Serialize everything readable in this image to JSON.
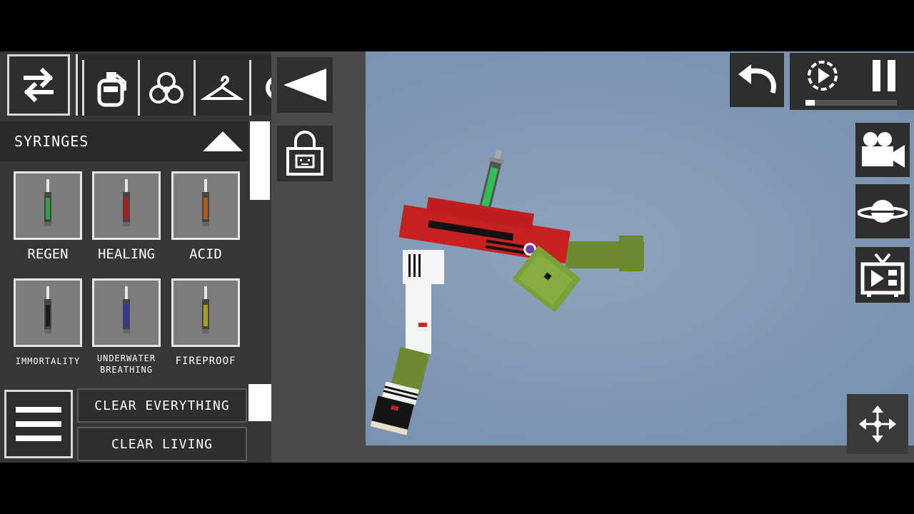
{
  "sidebar": {
    "category": "SYRINGES",
    "items": [
      {
        "label": "REGEN",
        "liquid": "#2fa14a"
      },
      {
        "label": "HEALING",
        "liquid": "#b21c1c"
      },
      {
        "label": "ACID",
        "liquid": "#b35a1a"
      },
      {
        "label": "IMMORTALITY",
        "liquid": "#1a1a1a"
      },
      {
        "label": "UNDERWATER BREATHING",
        "liquid": "#2f34a8"
      },
      {
        "label": "FIREPROOF",
        "liquid": "#a6a21a"
      }
    ],
    "clear_everything_label": "CLEAR EVERYTHING",
    "clear_living_label": "CLEAR LIVING"
  },
  "category_tabs": [
    "grenade-icon",
    "biohazard-icon",
    "clothes-hanger-icon"
  ],
  "hud": {
    "undo_icon": "undo-icon",
    "slowmo_icon": "slow-motion-icon",
    "pause_icon": "pause-icon",
    "camera_icon": "camera-icon",
    "environment_icon": "planet-icon",
    "tv_icon": "tv-icon",
    "move_icon": "move-arrows-icon",
    "slowmo_level": 0.1
  },
  "colors": {
    "panel": "#363636",
    "sky": "#7e96b2",
    "button": "#2e2e2e"
  }
}
